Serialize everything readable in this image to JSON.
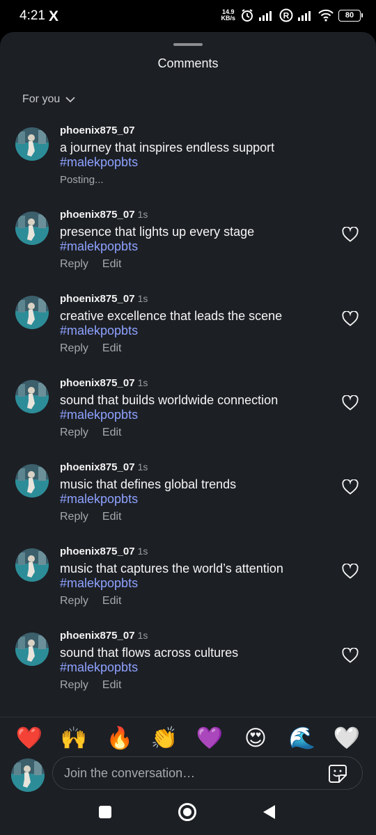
{
  "status_bar": {
    "time": "4:21",
    "app_icon": "X",
    "net_speed_value": "14.9",
    "net_speed_unit": "KB/s",
    "battery": "80"
  },
  "sheet": {
    "title": "Comments",
    "filter_label": "For you"
  },
  "comments": [
    {
      "username": "phoenix875_07",
      "time": "",
      "text": "a journey that inspires endless support",
      "hashtag": "#malekpopbts",
      "status": "Posting..."
    },
    {
      "username": "phoenix875_07",
      "time": "1s",
      "text": "presence that lights up every stage",
      "hashtag": "#malekpopbts",
      "reply": "Reply",
      "edit": "Edit"
    },
    {
      "username": "phoenix875_07",
      "time": "1s",
      "text": "creative excellence that leads the scene",
      "hashtag": "#malekpopbts",
      "reply": "Reply",
      "edit": "Edit"
    },
    {
      "username": "phoenix875_07",
      "time": "1s",
      "text": "sound that builds worldwide connection",
      "hashtag": "#malekpopbts",
      "reply": "Reply",
      "edit": "Edit"
    },
    {
      "username": "phoenix875_07",
      "time": "1s",
      "text": "music that defines global trends",
      "hashtag": "#malekpopbts",
      "reply": "Reply",
      "edit": "Edit"
    },
    {
      "username": "phoenix875_07",
      "time": "1s",
      "text": "music that captures the world’s attention",
      "hashtag": "#malekpopbts",
      "reply": "Reply",
      "edit": "Edit"
    },
    {
      "username": "phoenix875_07",
      "time": "1s",
      "text": "sound that flows across cultures",
      "hashtag": "#malekpopbts",
      "reply": "Reply",
      "edit": "Edit"
    }
  ],
  "emoji_reactions": [
    "❤️",
    "🙌",
    "🔥",
    "👏",
    "💜",
    "😍",
    "🌊",
    "🤍"
  ],
  "composer": {
    "placeholder": "Join the conversation…"
  },
  "colors": {
    "sheet_background": "#1c1f24",
    "hashtag": "#8ea2ff",
    "secondary_text": "#a6a9ae"
  },
  "icons": {
    "filter": "chevron-down-icon",
    "comment_like": "heart-outline-icon",
    "composer": "sticker-icon",
    "nav": [
      "recents-square-icon",
      "home-circle-icon",
      "back-triangle-icon"
    ]
  }
}
